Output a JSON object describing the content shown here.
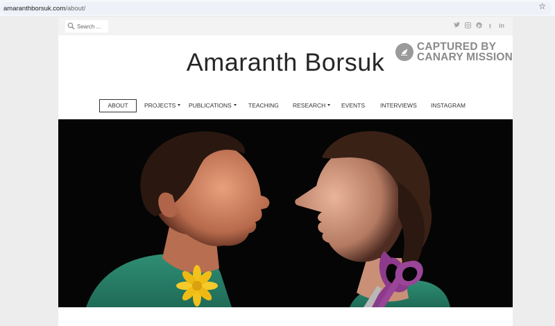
{
  "browser": {
    "url_domain": "amaranthborsuk.com",
    "url_path": "/about/"
  },
  "topbar": {
    "search_placeholder": "Search ...",
    "social_icons": [
      "twitter-icon",
      "instagram-icon",
      "pinterest-icon",
      "tumblr-icon",
      "linkedin-icon"
    ]
  },
  "site": {
    "title": "Amaranth Borsuk"
  },
  "badge": {
    "line1": "CAPTURED BY",
    "line2": "CANARY MISSION"
  },
  "nav": {
    "items": [
      {
        "label": "ABOUT",
        "active": true
      },
      {
        "label": "PROJECTS",
        "dropdown": true
      },
      {
        "label": "PUBLICATIONS",
        "dropdown": true
      },
      {
        "label": "TEACHING"
      },
      {
        "label": "RESEARCH",
        "dropdown": true
      },
      {
        "label": "EVENTS"
      },
      {
        "label": "INTERVIEWS"
      },
      {
        "label": "INSTAGRAM"
      }
    ]
  },
  "hero": {
    "alt": "Two people face to face in profile against a black background, a yellow flower and purple scissors in the foreground"
  },
  "colors": {
    "page_bg": "#ededed",
    "card_bg": "#ffffff",
    "topbar_bg": "#f3f3f3",
    "title": "#262626",
    "badge": "#8a8a8a",
    "shirt": "#2f8e74",
    "flower": "#f4c21b",
    "scissors": "#8e3a8c"
  }
}
